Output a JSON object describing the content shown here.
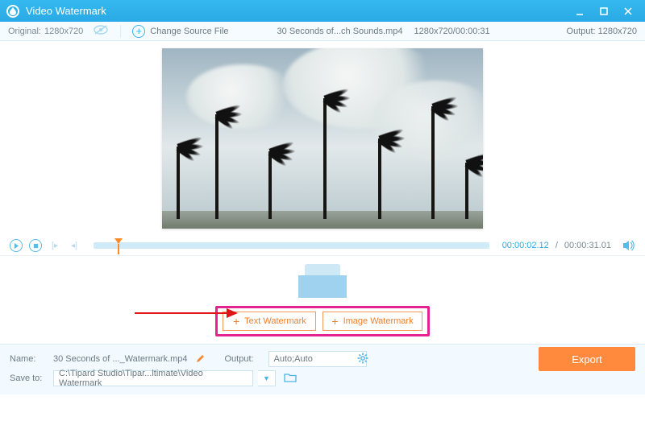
{
  "titlebar": {
    "title": "Video Watermark"
  },
  "subbar": {
    "original_label": "Original:",
    "original_res": "1280x720",
    "change_label": "Change Source File",
    "file_name": "30 Seconds of...ch Sounds.mp4",
    "file_meta": "1280x720/00:00:31",
    "output_label": "Output:",
    "output_res": "1280x720"
  },
  "controls": {
    "current_time": "00:00:02.12",
    "sep": "/",
    "total_time": "00:00:31.01"
  },
  "watermark": {
    "text_btn": "Text Watermark",
    "image_btn": "Image Watermark"
  },
  "bottom": {
    "name_label": "Name:",
    "name_value": "30 Seconds of ..._Watermark.mp4",
    "output_label": "Output:",
    "output_value": "Auto;Auto",
    "save_label": "Save to:",
    "save_value": "C:\\Tipard Studio\\Tipar...ltimate\\Video Watermark",
    "export": "Export"
  }
}
